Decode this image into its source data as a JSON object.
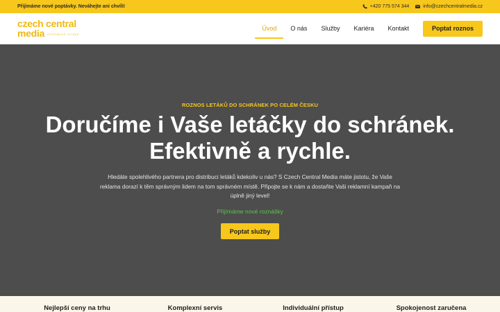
{
  "topbar": {
    "announcement": "Přijímáme nové poptávky. Neváhejte ani chvíli!",
    "phone": "+420 775 574 344",
    "email": "info@czechcentralmedia.cz",
    "phone_icon": "phone-icon",
    "email_icon": "envelope-icon",
    "background_color": "#f7c71b"
  },
  "header": {
    "logo_line1": "czech central",
    "logo_line2": "media",
    "logo_tagline": "DISTRIBUCE LETÁKŮ",
    "nav": [
      {
        "label": "Úvod",
        "active": true
      },
      {
        "label": "O nás",
        "active": false
      },
      {
        "label": "Služby",
        "active": false
      },
      {
        "label": "Kariéra",
        "active": false
      },
      {
        "label": "Kontakt",
        "active": false
      }
    ],
    "cta_label": "Poptat roznos"
  },
  "hero": {
    "eyebrow": "ROZNOS LETÁKŮ DO SCHRÁNEK PO CELÉM ČESKU",
    "headline": "Doručíme i Vaše letáčky do schránek. Efektivně a rychle.",
    "description": "Hledáte spolehlivého partnera pro distribuci letáků kdekoliv u nás? S Czech Central Media máte jistotu, že Vaše reklama dorazí k těm správným lidem na tom správném místě. Připojte se k nám a dostaňte Vaši reklamní kampaň na úplně jiný level!",
    "recruiting_note": "Přijímáme nové roznášky",
    "cta_label": "Poptat služby",
    "background_color": "#4d4d4d",
    "accent_color": "#f7c71b",
    "note_color": "#5cc644"
  },
  "features": [
    {
      "title": "Nejlepší ceny na trhu"
    },
    {
      "title": "Komplexní servis"
    },
    {
      "title": "Individuální přístup"
    },
    {
      "title": "Spokojenost zaručena"
    }
  ]
}
